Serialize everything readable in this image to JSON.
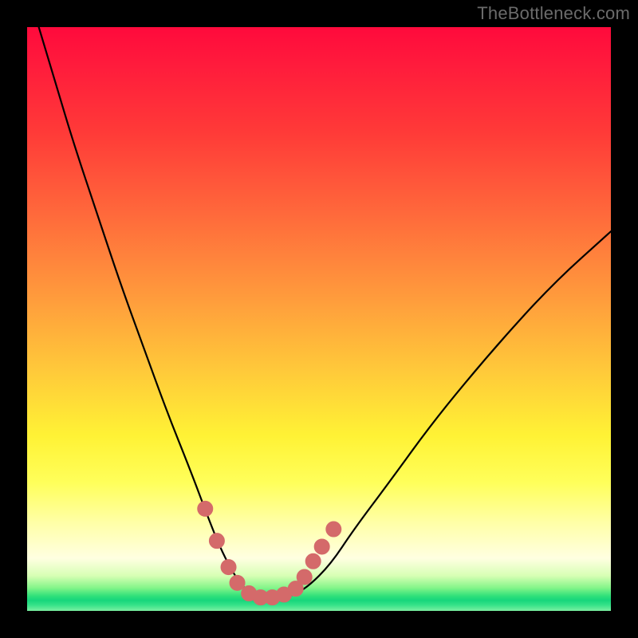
{
  "watermark": {
    "text": "TheBottleneck.com"
  },
  "colors": {
    "curve_stroke": "#000000",
    "marker_fill": "#d46a6a",
    "marker_stroke": "#d46a6a"
  },
  "chart_data": {
    "type": "line",
    "title": "",
    "xlabel": "",
    "ylabel": "",
    "xlim": [
      0,
      100
    ],
    "ylim": [
      0,
      100
    ],
    "grid": false,
    "legend": false,
    "series": [
      {
        "name": "bottleneck-curve",
        "x": [
          2,
          5,
          8,
          12,
          16,
          20,
          24,
          28,
          31,
          33,
          35,
          37,
          39,
          41,
          43,
          45,
          48,
          52,
          56,
          62,
          70,
          80,
          90,
          100
        ],
        "y": [
          100,
          90,
          80,
          68,
          56,
          45,
          34,
          24,
          16,
          11,
          7,
          4,
          2.5,
          2,
          2,
          2.5,
          4,
          8,
          14,
          22,
          33,
          45,
          56,
          65
        ]
      }
    ],
    "markers": {
      "name": "valley-markers",
      "x": [
        30.5,
        32.5,
        34.5,
        36.0,
        38.0,
        40.0,
        42.0,
        44.0,
        46.0,
        47.5,
        49.0,
        50.5,
        52.5
      ],
      "y": [
        17.5,
        12.0,
        7.5,
        4.8,
        3.0,
        2.3,
        2.3,
        2.8,
        3.8,
        5.8,
        8.5,
        11.0,
        14.0
      ]
    }
  }
}
